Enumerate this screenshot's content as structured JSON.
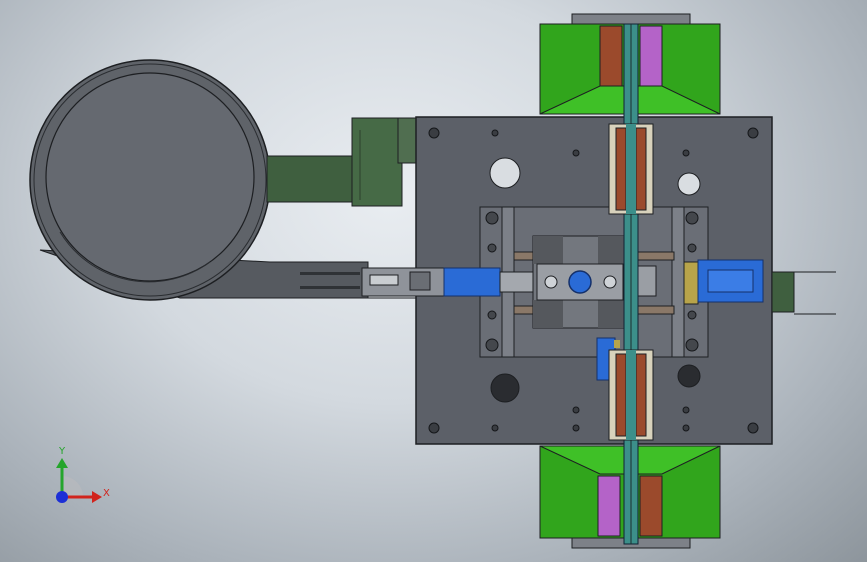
{
  "viewport": {
    "view_name": "cad-assembly-top-view",
    "background_top": "#e9edf1",
    "background_bottom": "#8d959c"
  },
  "triad": {
    "x_label": "X",
    "y_label": "Y",
    "x_color": "#d1241d",
    "y_color": "#25a52c",
    "z_color": "#1c2fd6"
  },
  "colors": {
    "plate": "#5c6068",
    "plate_edge": "#1d1f22",
    "bowl": "#5f6369",
    "hopper_green": "#31a51c",
    "feeder_green": "#3f5f3f",
    "copper": "#9b4a2c",
    "blue_cylinder": "#2a6bd6",
    "magenta_block": "#b463c8"
  }
}
